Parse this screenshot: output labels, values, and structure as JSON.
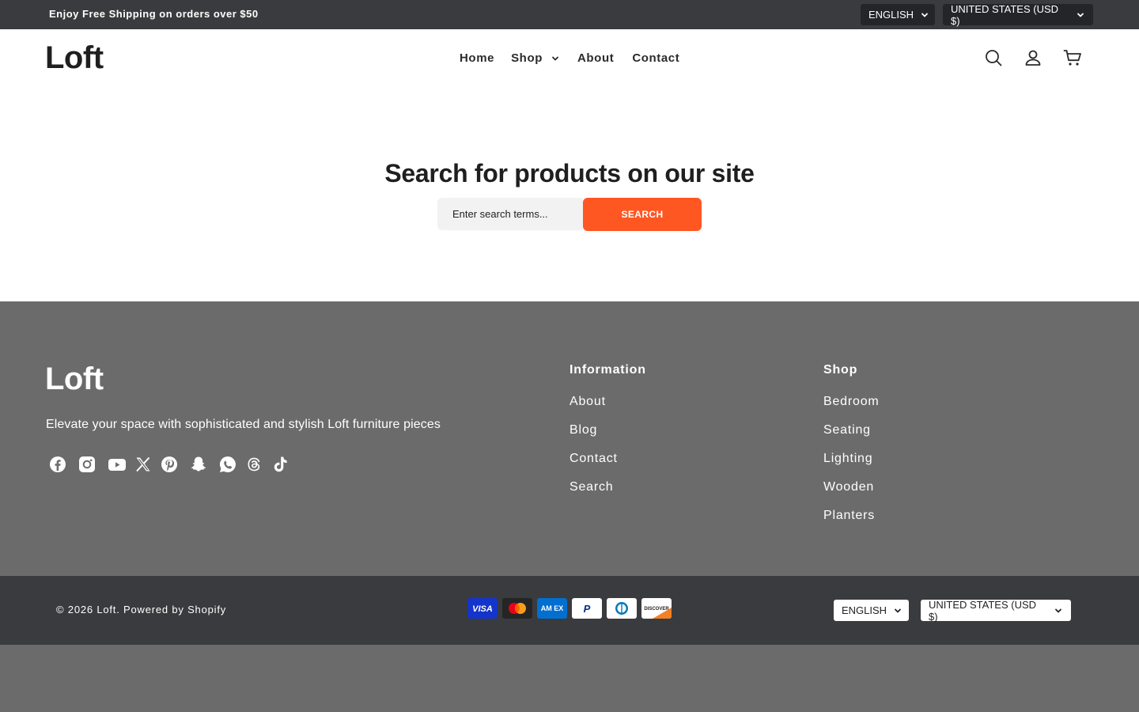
{
  "announcement": {
    "message": "Enjoy Free Shipping on orders over $50",
    "language": "ENGLISH",
    "currency": "UNITED STATES (USD $)"
  },
  "header": {
    "logo": "Loft",
    "nav": [
      {
        "label": "Home"
      },
      {
        "label": "Shop"
      },
      {
        "label": "About"
      },
      {
        "label": "Contact"
      }
    ],
    "icons": [
      "search-icon",
      "account-icon",
      "cart-icon"
    ]
  },
  "search": {
    "title": "Search for products on our site",
    "placeholder": "Enter search terms...",
    "value": "",
    "button_label": "SEARCH"
  },
  "footer": {
    "logo": "Loft",
    "tagline": "Elevate your space with sophisticated and stylish Loft furniture pieces",
    "socials": [
      "facebook-icon",
      "instagram-icon",
      "youtube-icon",
      "x-icon",
      "pinterest-icon",
      "snapchat-icon",
      "whatsapp-icon",
      "threads-icon",
      "tiktok-icon"
    ],
    "columns": [
      {
        "title": "Information",
        "links": [
          "About",
          "Blog",
          "Contact",
          "Search"
        ]
      },
      {
        "title": "Shop",
        "links": [
          "Bedroom",
          "Seating",
          "Lighting",
          "Wooden",
          "Planters"
        ]
      }
    ]
  },
  "bottom": {
    "copyright": "© 2026 Loft. Powered by Shopify",
    "payments": [
      {
        "name": "visa-icon",
        "label": "VISA"
      },
      {
        "name": "mastercard-icon",
        "label": ""
      },
      {
        "name": "amex-icon",
        "label": "AM EX"
      },
      {
        "name": "paypal-icon",
        "label": "P"
      },
      {
        "name": "diners-icon",
        "label": ""
      },
      {
        "name": "discover-icon",
        "label": "DISCOVER"
      }
    ],
    "language": "ENGLISH",
    "currency": "UNITED STATES (USD $)"
  },
  "colors": {
    "accent": "#ff5722",
    "topbar": "#3a3b3e",
    "footer": "#6b6b6b"
  }
}
